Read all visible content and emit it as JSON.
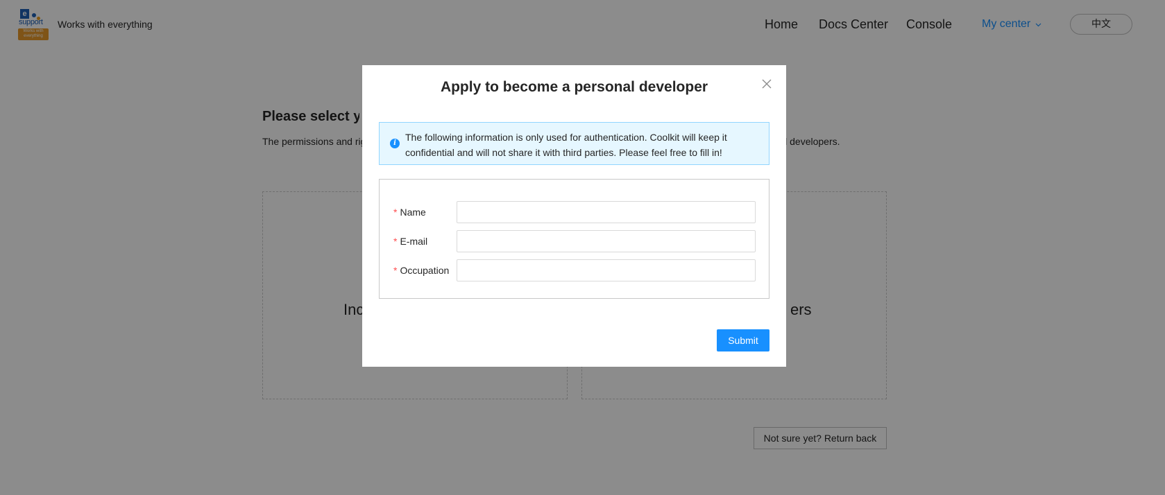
{
  "header": {
    "logo": {
      "letter": "e",
      "word": "support",
      "badge": "Works with everything"
    },
    "tagline": "Works with everything",
    "nav": {
      "home": "Home",
      "docs": "Docs Center",
      "console": "Console",
      "my_center": "My center"
    },
    "language_button": "中文"
  },
  "background": {
    "title": "Please select yo",
    "description": "The permissions and rig                                                                                                                                        an individual developers.",
    "card_left_label": "Inc",
    "card_right_label": "ers",
    "back_button": "Not sure yet? Return back"
  },
  "modal": {
    "title": "Apply to become a personal developer",
    "info": "The following information is only used for authentication. Coolkit will keep it confidential and will not share it with third parties. Please feel free to fill in!",
    "fields": [
      {
        "label": "Name",
        "value": "",
        "placeholder": ""
      },
      {
        "label": "E-mail",
        "value": "",
        "placeholder": ""
      },
      {
        "label": "Occupation",
        "value": "",
        "placeholder": ""
      }
    ],
    "required_mark": "*",
    "submit": "Submit"
  },
  "icons": {
    "close": "close-icon",
    "info": "info-icon",
    "chevron": "chevron-down-icon"
  },
  "colors": {
    "primary": "#1890ff",
    "required": "#ff4d4f",
    "info_bg": "#e6f7ff",
    "info_border": "#91d5ff",
    "logo_blue": "#1e5fb4",
    "logo_orange": "#e89a2b"
  }
}
